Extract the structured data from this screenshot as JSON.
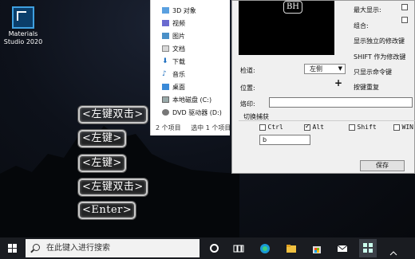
{
  "desktop": {
    "icon_label": "Materials Studio 2020"
  },
  "key_overlays": [
    {
      "label": "<左键双击>"
    },
    {
      "label": "<左键>"
    },
    {
      "label": "<左键>"
    },
    {
      "label": "<左键双击>"
    },
    {
      "label": "<Enter>"
    }
  ],
  "explorer": {
    "items": [
      {
        "label": "3D 对象",
        "icon": "cube-icon"
      },
      {
        "label": "视频",
        "icon": "video-icon"
      },
      {
        "label": "图片",
        "icon": "picture-icon"
      },
      {
        "label": "文档",
        "icon": "document-icon"
      },
      {
        "label": "下载",
        "icon": "download-icon"
      },
      {
        "label": "音乐",
        "icon": "music-icon"
      },
      {
        "label": "桌面",
        "icon": "desktop-icon"
      },
      {
        "label": "本地磁盘 (C:)",
        "icon": "drive-icon"
      },
      {
        "label": "DVD 驱动器 (D:)",
        "icon": "dvd-icon"
      }
    ],
    "status_count": "2 个项目",
    "status_selected": "选中 1 个项目"
  },
  "dialog": {
    "preview_text": "BH",
    "max_display_label": "最大显示:",
    "combo_label": "组合:",
    "show_modifier_label": "显示独立的修改键",
    "shift_modifier_label": "SHIFT 作为修改键",
    "show_command_label": "只显示命令键",
    "repeat_label": "按键重复",
    "edge_label": "检道:",
    "edge_value": "左侧",
    "position_label": "位置:",
    "plus_label": "+",
    "stamp_label": "烙印:",
    "stamp_value": "",
    "capture_group_label": "切换捕获",
    "ctrl_label": "Ctrl",
    "alt_label": "Alt",
    "shift_label": "Shift",
    "win_label": "WIN",
    "hotkey_value": "b",
    "save_label": "保存"
  },
  "taskbar": {
    "search_placeholder": "在此键入进行搜索"
  },
  "colors": {
    "accent": "#0078d7",
    "taskbar": "#1a1c21"
  }
}
